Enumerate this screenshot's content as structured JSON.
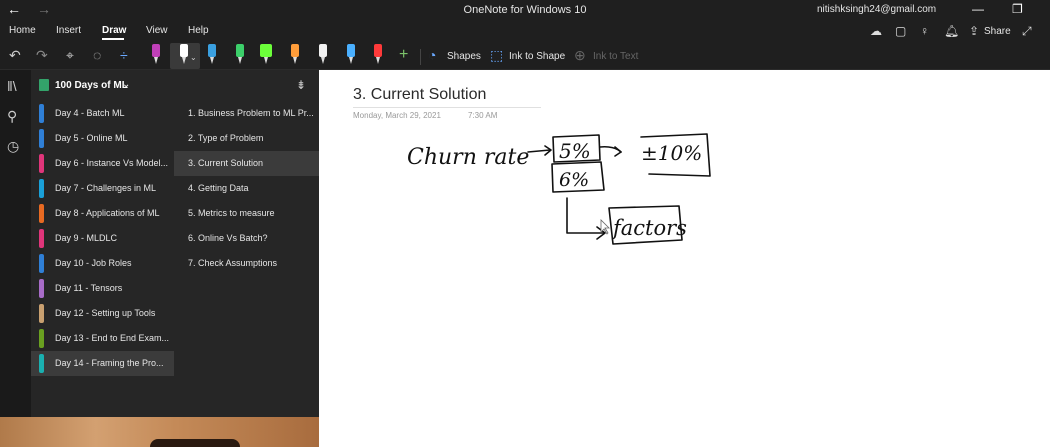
{
  "titlebar": {
    "app_title": "OneNote for Windows 10",
    "user_email": "nitishksingh24@gmail.com"
  },
  "menu": {
    "tabs": [
      "Home",
      "Insert",
      "Draw",
      "View",
      "Help"
    ],
    "active_tab": "Draw",
    "share_label": "Share"
  },
  "ribbon": {
    "shapes_label": "Shapes",
    "ink_to_shape_label": "Ink to Shape",
    "ink_to_text_label": "Ink to Text",
    "pen_colors": [
      "#c03fb8",
      "#ffffff",
      "#3aa0e0",
      "#3ccf6a",
      "#6cff3a",
      "#ff9d3a",
      "#f2f2f2",
      "#4ab0ff",
      "#ff3a3a"
    ]
  },
  "notebook": {
    "title": "100 Days of ML",
    "sections": [
      {
        "label": "Day 4 - Batch ML",
        "color": "#2f7fd6"
      },
      {
        "label": "Day 5 - Online ML",
        "color": "#2f7fd6"
      },
      {
        "label": "Day 6 - Instance Vs Model...",
        "color": "#e0357a"
      },
      {
        "label": "Day 7 - Challenges in ML",
        "color": "#1aa0d8"
      },
      {
        "label": "Day 8 - Applications of ML",
        "color": "#e86a22"
      },
      {
        "label": "Day 9 - MLDLC",
        "color": "#e0357a"
      },
      {
        "label": "Day 10 - Job Roles",
        "color": "#2f7fd6"
      },
      {
        "label": "Day 11 - Tensors",
        "color": "#a86cc8"
      },
      {
        "label": "Day 12 - Setting up Tools",
        "color": "#c9a070"
      },
      {
        "label": "Day 13 - End to End Exam...",
        "color": "#6aa020"
      },
      {
        "label": "Day 14 - Framing the Pro...",
        "color": "#1ab0b0"
      }
    ],
    "active_section": 10
  },
  "pages": {
    "items": [
      "1. Business Problem to ML Pr...",
      "2. Type of Problem",
      "3. Current Solution",
      "4. Getting Data",
      "5. Metrics to measure",
      "6. Online Vs Batch?",
      "7. Check Assumptions"
    ],
    "active_page": 2
  },
  "page": {
    "title": "3. Current Solution",
    "date": "Monday, March 29, 2021",
    "time": "7:30 AM"
  },
  "ink": {
    "churn_rate": "Churn rate",
    "box1": "5%",
    "box2": "±10%",
    "box3": "6%",
    "box4": "factors"
  }
}
